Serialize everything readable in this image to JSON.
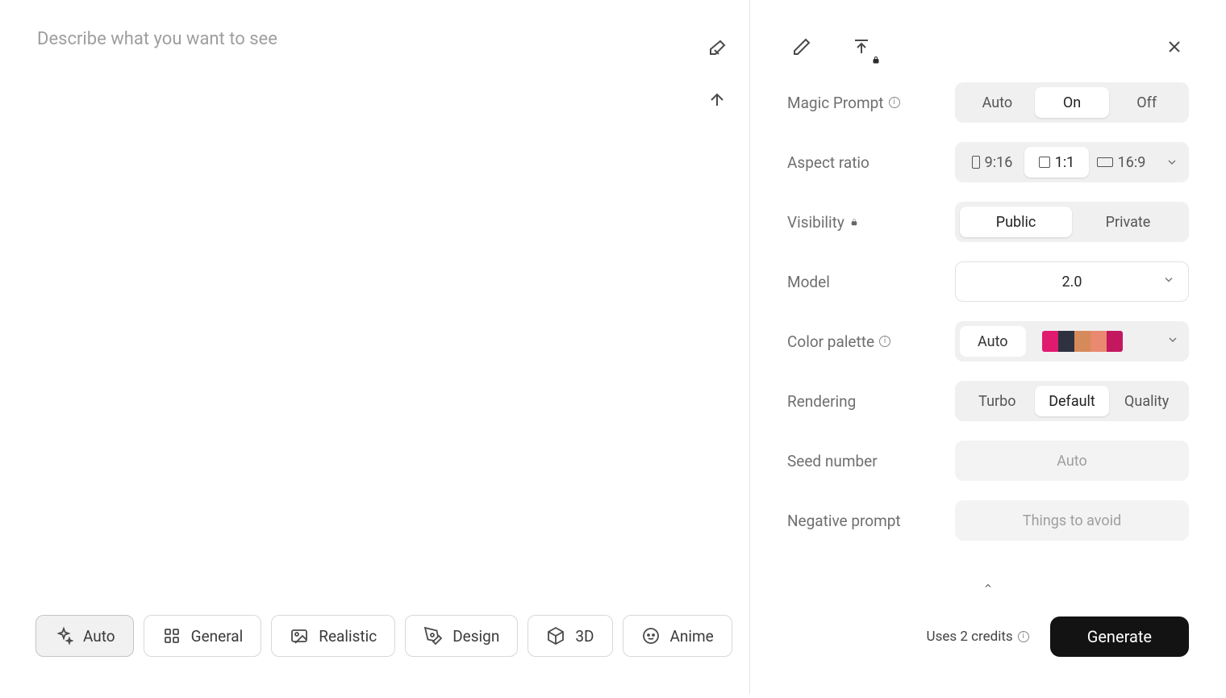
{
  "prompt": {
    "placeholder": "Describe what you want to see",
    "value": ""
  },
  "styles": {
    "auto": "Auto",
    "general": "General",
    "realistic": "Realistic",
    "design": "Design",
    "threeD": "3D",
    "anime": "Anime",
    "selected": "auto"
  },
  "settings": {
    "magicPrompt": {
      "label": "Magic Prompt",
      "options": [
        "Auto",
        "On",
        "Off"
      ],
      "selected": "On"
    },
    "aspectRatio": {
      "label": "Aspect ratio",
      "options": [
        "9:16",
        "1:1",
        "16:9"
      ],
      "selected": "1:1"
    },
    "visibility": {
      "label": "Visibility",
      "options": [
        "Public",
        "Private"
      ],
      "selected": "Public"
    },
    "model": {
      "label": "Model",
      "value": "2.0"
    },
    "colorPalette": {
      "label": "Color palette",
      "mode": "Auto",
      "swatches": [
        "#e01a6f",
        "#2e3140",
        "#d68a5a",
        "#e88970",
        "#c3185f"
      ]
    },
    "rendering": {
      "label": "Rendering",
      "options": [
        "Turbo",
        "Default",
        "Quality"
      ],
      "selected": "Default"
    },
    "seed": {
      "label": "Seed number",
      "placeholder": "Auto",
      "value": ""
    },
    "negative": {
      "label": "Negative prompt",
      "placeholder": "Things to avoid",
      "value": ""
    }
  },
  "footer": {
    "credits": "Uses 2 credits",
    "generate": "Generate"
  }
}
